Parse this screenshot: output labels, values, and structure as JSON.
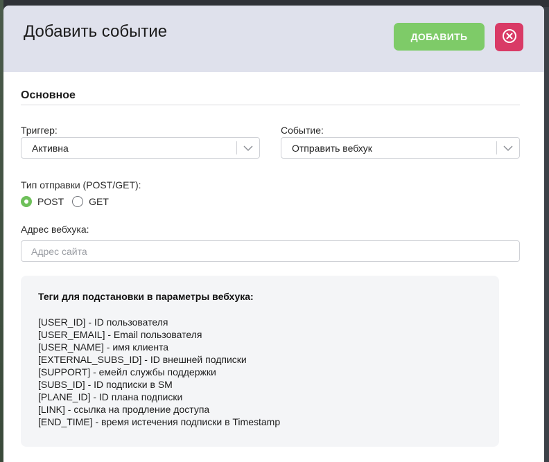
{
  "modal": {
    "title": "Добавить событие",
    "add_button_label": "ДОБАВИТЬ",
    "close_icon": "close-circle-icon"
  },
  "colors": {
    "header_bg": "#dfe1ec",
    "add_button": "#7ecb68",
    "close_button": "#d93a66",
    "radio_checked": "#6ec05a",
    "tags_bg": "#f4f5f7"
  },
  "section": {
    "title": "Основное"
  },
  "trigger": {
    "label": "Триггер:",
    "value": "Активна",
    "icon": "chevron-down-icon"
  },
  "event": {
    "label": "Событие:",
    "value": "Отправить вебхук",
    "icon": "chevron-down-icon"
  },
  "send_type": {
    "label": "Тип отправки (POST/GET):",
    "options": [
      {
        "label": "POST",
        "checked": true
      },
      {
        "label": "GET",
        "checked": false
      }
    ]
  },
  "webhook": {
    "label": "Адрес вебхука:",
    "value": "",
    "placeholder": "Адрес сайта"
  },
  "tags": {
    "title": "Теги для подстановки в параметры вебхука:",
    "items": [
      "[USER_ID] - ID пользователя",
      "[USER_EMAIL] - Email пользователя",
      "[USER_NAME] - имя клиента",
      "[EXTERNAL_SUBS_ID] - ID внешней подписки",
      "[SUPPORT] - емейл службы поддержки",
      "[SUBS_ID] - ID подписки в SM",
      "[PLANE_ID] - ID плана подписки",
      "[LINK] - ссылка на продление доступа",
      "[END_TIME] - время истечения подписки в Timestamp"
    ]
  }
}
